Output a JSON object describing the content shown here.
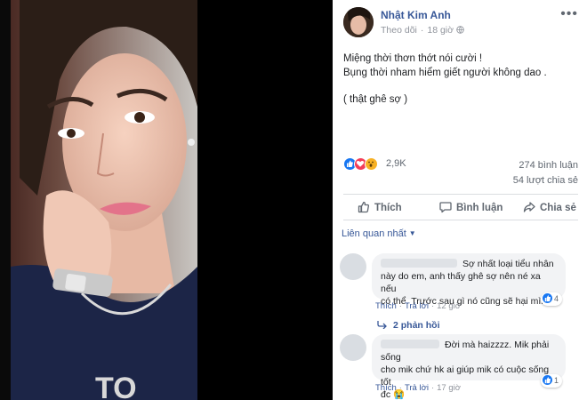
{
  "post": {
    "author": "Nhật Kim Anh",
    "follow": "Theo dõi",
    "time": "18 giờ",
    "more": "•••",
    "lines": [
      "Miệng thời thơn thớt nói cười !",
      "Bụng thời nham hiểm giết người không dao ."
    ],
    "footer_line": "( thật ghê sợ )",
    "reactions_count": "2,9K",
    "comments_count": "274 bình luận",
    "shares_count": "54 lượt chia sẻ",
    "reaction_icons": [
      "like-icon",
      "love-icon",
      "wow-icon"
    ],
    "colors": {
      "link": "#385898",
      "like": "#1877f2",
      "love": "#f33e58",
      "wow": "#f7b125"
    }
  },
  "actions": {
    "like": "Thích",
    "comment": "Bình luận",
    "share": "Chia sẻ"
  },
  "related_label": "Liên quan nhất",
  "comments": [
    {
      "text": "Sợ nhất loại tiểu nhân này do em, anh thấy ghê sợ nên né xa nếu có thể. Trước sau gì nó cũng sẽ hại mình.",
      "line1": "Sợ nhất loại tiểu nhân",
      "line2": "này do em, anh thấy ghê sợ nên né xa nếu",
      "line3": "có thể. Trước sau gì nó cũng sẽ hại mình.",
      "likes": "4",
      "like_label": "Thích",
      "reply_label": "Trả lời",
      "time": "12 giờ",
      "replies": "2 phản hồi"
    },
    {
      "line1": "Đời mà haizzzz. Mik phải sống",
      "line2": "cho mik chứ hk ai giúp mik có cuộc sống tốt",
      "line3": "đc 😭",
      "likes": "1",
      "like_label": "Thích",
      "reply_label": "Trả lời",
      "time": "17 giờ"
    }
  ]
}
